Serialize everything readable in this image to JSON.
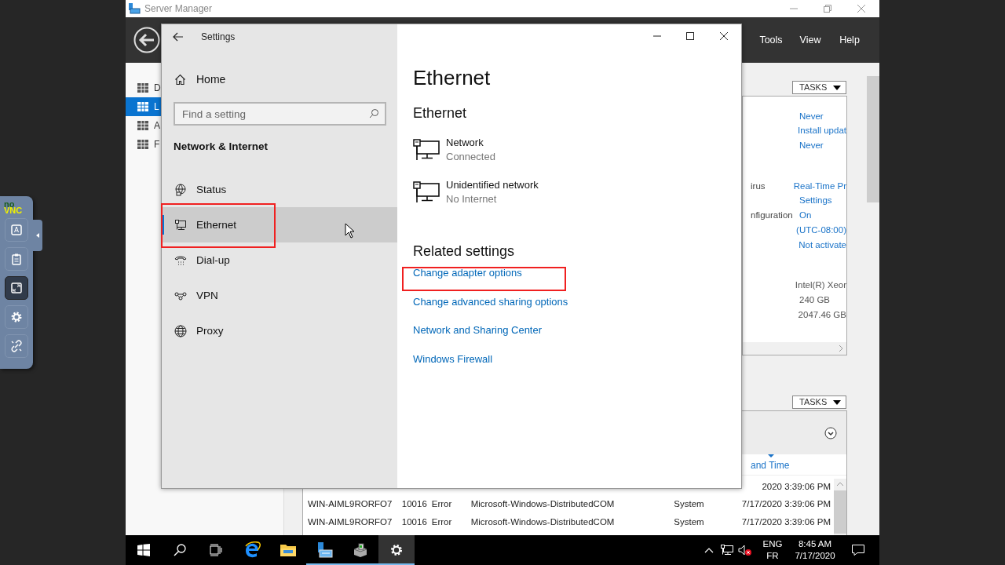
{
  "vnc_panel": {
    "logo": [
      "no",
      "VNC"
    ],
    "tools": [
      {
        "kind": "keyboard",
        "selected": false
      },
      {
        "kind": "clipboard",
        "selected": false
      },
      {
        "kind": "fullscreen",
        "selected": true
      },
      {
        "kind": "settings",
        "selected": false
      },
      {
        "kind": "disconnect",
        "selected": false
      }
    ]
  },
  "server_manager": {
    "title": "Server Manager",
    "menu": [
      "Tools",
      "View",
      "Help"
    ],
    "nav": [
      {
        "label": "D",
        "selected": false
      },
      {
        "label": "L",
        "selected": true
      },
      {
        "label": "A",
        "selected": false
      },
      {
        "label": "F",
        "selected": false
      }
    ],
    "properties": {
      "tasks": "TASKS",
      "groups": [
        [
          {
            "value": "Never",
            "link": true
          },
          {
            "value": "Install updat",
            "link": true
          },
          {
            "value": "Never",
            "link": true
          }
        ],
        [
          {
            "label": "irus",
            "value": "Real-Time Pr",
            "link": true
          },
          {
            "value": "Settings",
            "link": true
          },
          {
            "label": "nfiguration",
            "value": "On",
            "link": true
          },
          {
            "value": "(UTC-08:00)",
            "link": true
          },
          {
            "value": "Not activate",
            "link": true
          }
        ],
        [
          {
            "value": "Intel(R) Xeor",
            "link": false
          },
          {
            "value": "240 GB",
            "link": false
          },
          {
            "value": "2047.46 GB",
            "link": false
          }
        ]
      ]
    },
    "events": {
      "tasks": "TASKS",
      "column": "and Time",
      "rows": [
        {
          "time": "2020 3:39:06 PM"
        },
        {
          "server": "WIN-AIML9RORFO7",
          "id": "10016",
          "severity": "Error",
          "source": "Microsoft-Windows-DistributedCOM",
          "log": "System",
          "time": "7/17/2020 3:39:06 PM"
        },
        {
          "server": "WIN-AIML9RORFO7",
          "id": "10016",
          "severity": "Error",
          "source": "Microsoft-Windows-DistributedCOM",
          "log": "System",
          "time": "7/17/2020 3:39:06 PM"
        }
      ]
    }
  },
  "settings": {
    "title": "Settings",
    "home": "Home",
    "search_placeholder": "Find a setting",
    "section": "Network & Internet",
    "nav": [
      {
        "label": "Status",
        "selected": false,
        "annotated": false
      },
      {
        "label": "Ethernet",
        "selected": true,
        "annotated": true
      },
      {
        "label": "Dial-up",
        "selected": false,
        "annotated": false
      },
      {
        "label": "VPN",
        "selected": false,
        "annotated": false
      },
      {
        "label": "Proxy",
        "selected": false,
        "annotated": false
      }
    ],
    "page_title": "Ethernet",
    "subheading": "Ethernet",
    "networks": [
      {
        "name": "Network",
        "status": "Connected"
      },
      {
        "name": "Unidentified network",
        "status": "No Internet"
      }
    ],
    "related_heading": "Related settings",
    "links": [
      {
        "label": "Change adapter options",
        "annotated": true
      },
      {
        "label": "Change advanced sharing options",
        "annotated": false
      },
      {
        "label": "Network and Sharing Center",
        "annotated": false
      },
      {
        "label": "Windows Firewall",
        "annotated": false
      }
    ]
  },
  "taskbar": {
    "apps": [
      {
        "kind": "start",
        "running": false,
        "active": false
      },
      {
        "kind": "search",
        "running": false,
        "active": false
      },
      {
        "kind": "taskview",
        "running": false,
        "active": false
      },
      {
        "kind": "browser",
        "running": false,
        "active": false
      },
      {
        "kind": "folder",
        "running": false,
        "active": false
      },
      {
        "kind": "servermanager",
        "running": true,
        "active": false
      },
      {
        "kind": "app",
        "running": true,
        "active": false
      },
      {
        "kind": "settings",
        "running": true,
        "active": true
      }
    ],
    "language": [
      "ENG",
      "FR"
    ],
    "time": "8:45 AM",
    "date": "7/17/2020"
  }
}
